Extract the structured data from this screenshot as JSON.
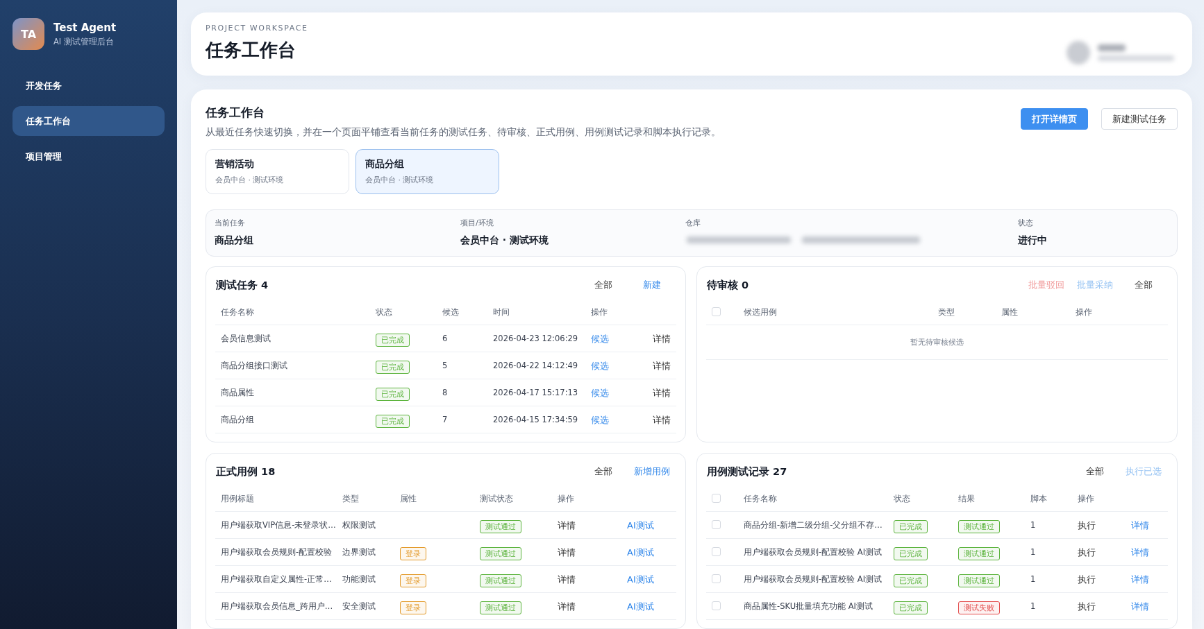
{
  "sidebar": {
    "logo": "TA",
    "app_name": "Test Agent",
    "app_subtitle": "AI 测试管理后台",
    "items": [
      {
        "label": "开发任务",
        "selected": false
      },
      {
        "label": "任务工作台",
        "selected": true
      },
      {
        "label": "项目管理",
        "selected": false
      }
    ]
  },
  "header": {
    "eyebrow": "PROJECT WORKSPACE",
    "title": "任务工作台",
    "profile": {
      "kind": "redacted"
    }
  },
  "workspace": {
    "title": "任务工作台",
    "description": "从最近任务快速切换，并在一个页面平铺查看当前任务的测试任务、待审核、正式用例、用例测试记录和脚本执行记录。",
    "buttons": [
      {
        "label": "打开详情页",
        "kind": "primary"
      },
      {
        "label": "新建测试任务",
        "kind": "default"
      }
    ],
    "recent_tasks": [
      {
        "name": "营销活动",
        "meta": "会员中台 · 测试环境",
        "selected": false
      },
      {
        "name": "商品分组",
        "meta": "会员中台 · 测试环境",
        "selected": true
      }
    ],
    "info": [
      {
        "label": "当前任务",
        "kind": "text",
        "value": "商品分组"
      },
      {
        "label": "项目/环境",
        "kind": "text",
        "value": "会员中台 · 测试环境"
      },
      {
        "label": "仓库",
        "kind": "redacted"
      },
      {
        "label": "状态",
        "kind": "text",
        "value": "进行中"
      }
    ],
    "panels": [
      {
        "kind": "tasks",
        "title": "测试任务",
        "count": "4",
        "actions": [
          {
            "label": "全部",
            "kind": "plain",
            "disabled": false
          },
          {
            "label": "新建",
            "kind": "link",
            "disabled": false
          }
        ],
        "columns": [
          "任务名称",
          "状态",
          "候选",
          "时间",
          "操作"
        ],
        "rows": [
          {
            "cells": [
              {
                "kind": "text",
                "text": "会员信息测试"
              },
              {
                "kind": "tag",
                "color": "#5bb33c",
                "text": "已完成"
              },
              {
                "kind": "text",
                "text": "6"
              },
              {
                "kind": "text",
                "text": "2026-04-23 12:06:29"
              },
              {
                "kind": "link",
                "text": "候选"
              },
              {
                "kind": "action",
                "text": "详情"
              }
            ]
          },
          {
            "cells": [
              {
                "kind": "text",
                "text": "商品分组接口测试"
              },
              {
                "kind": "tag",
                "color": "#5bb33c",
                "text": "已完成"
              },
              {
                "kind": "text",
                "text": "5"
              },
              {
                "kind": "text",
                "text": "2026-04-22 14:12:49"
              },
              {
                "kind": "link",
                "text": "候选"
              },
              {
                "kind": "action",
                "text": "详情"
              }
            ]
          },
          {
            "cells": [
              {
                "kind": "text",
                "text": "商品属性"
              },
              {
                "kind": "tag",
                "color": "#5bb33c",
                "text": "已完成"
              },
              {
                "kind": "text",
                "text": "8"
              },
              {
                "kind": "text",
                "text": "2026-04-17 15:17:13"
              },
              {
                "kind": "link",
                "text": "候选"
              },
              {
                "kind": "action",
                "text": "详情"
              }
            ]
          },
          {
            "cells": [
              {
                "kind": "text",
                "text": "商品分组"
              },
              {
                "kind": "tag",
                "color": "#5bb33c",
                "text": "已完成"
              },
              {
                "kind": "text",
                "text": "7"
              },
              {
                "kind": "text",
                "text": "2026-04-15 17:34:59"
              },
              {
                "kind": "link",
                "text": "候选"
              },
              {
                "kind": "action",
                "text": "详情"
              }
            ]
          }
        ]
      },
      {
        "kind": "review",
        "title": "待审核",
        "count": "0",
        "actions": [
          {
            "label": "批量驳回",
            "kind": "danger",
            "disabled": true
          },
          {
            "label": "批量采纳",
            "kind": "link",
            "disabled": true
          },
          {
            "label": "全部",
            "kind": "plain",
            "disabled": false
          }
        ],
        "header_checked": false,
        "columns": [
          "候选用例",
          "类型",
          "属性",
          "操作"
        ],
        "empty_text": "暂无待审核候选"
      },
      {
        "kind": "cases",
        "title": "正式用例",
        "count": "18",
        "actions": [
          {
            "label": "全部",
            "kind": "plain",
            "disabled": false
          },
          {
            "label": "新增用例",
            "kind": "link",
            "disabled": false
          }
        ],
        "columns": [
          "用例标题",
          "类型",
          "属性",
          "测试状态",
          "操作"
        ],
        "rows": [
          {
            "cells": [
              {
                "kind": "text",
                "text": "用户端获取VIP信息-未登录状…"
              },
              {
                "kind": "text",
                "text": "权限测试"
              },
              {
                "kind": "blank"
              },
              {
                "kind": "tag",
                "color": "#5bb33c",
                "text": "测试通过"
              },
              {
                "kind": "action",
                "text": "详情"
              },
              {
                "kind": "link",
                "text": "AI测试"
              }
            ]
          },
          {
            "cells": [
              {
                "kind": "text",
                "text": "用户端获取会员规则-配置校验"
              },
              {
                "kind": "text",
                "text": "边界测试"
              },
              {
                "kind": "tag",
                "color": "#e39a2a",
                "text": "登录"
              },
              {
                "kind": "tag",
                "color": "#5bb33c",
                "text": "测试通过"
              },
              {
                "kind": "action",
                "text": "详情"
              },
              {
                "kind": "link",
                "text": "AI测试"
              }
            ]
          },
          {
            "cells": [
              {
                "kind": "text",
                "text": "用户端获取自定义属性-正常…"
              },
              {
                "kind": "text",
                "text": "功能测试"
              },
              {
                "kind": "tag",
                "color": "#e39a2a",
                "text": "登录"
              },
              {
                "kind": "tag",
                "color": "#5bb33c",
                "text": "测试通过"
              },
              {
                "kind": "action",
                "text": "详情"
              },
              {
                "kind": "link",
                "text": "AI测试"
              }
            ]
          },
          {
            "cells": [
              {
                "kind": "text",
                "text": "用户端获取会员信息_跨用户…"
              },
              {
                "kind": "text",
                "text": "安全测试"
              },
              {
                "kind": "tag",
                "color": "#e39a2a",
                "text": "登录"
              },
              {
                "kind": "tag",
                "color": "#5bb33c",
                "text": "测试通过"
              },
              {
                "kind": "action",
                "text": "详情"
              },
              {
                "kind": "link",
                "text": "AI测试"
              }
            ]
          }
        ]
      },
      {
        "kind": "records",
        "title": "用例测试记录",
        "count": "27",
        "actions": [
          {
            "label": "全部",
            "kind": "plain",
            "disabled": false
          },
          {
            "label": "执行已选",
            "kind": "link",
            "disabled": true
          }
        ],
        "header_checked": false,
        "columns": [
          "任务名称",
          "状态",
          "结果",
          "脚本",
          "操作"
        ],
        "rows": [
          {
            "checked": false,
            "cells": [
              {
                "kind": "text",
                "text": "商品分组-新增二级分组-父分组不存…"
              },
              {
                "kind": "tag",
                "color": "#5bb33c",
                "text": "已完成"
              },
              {
                "kind": "tag",
                "color": "#5bb33c",
                "text": "测试通过"
              },
              {
                "kind": "text",
                "text": "1"
              },
              {
                "kind": "action",
                "text": "执行"
              },
              {
                "kind": "link",
                "text": "详情"
              }
            ]
          },
          {
            "checked": false,
            "cells": [
              {
                "kind": "text",
                "text": "用户端获取会员规则-配置校验 AI测试"
              },
              {
                "kind": "tag",
                "color": "#5bb33c",
                "text": "已完成"
              },
              {
                "kind": "tag",
                "color": "#5bb33c",
                "text": "测试通过"
              },
              {
                "kind": "text",
                "text": "1"
              },
              {
                "kind": "action",
                "text": "执行"
              },
              {
                "kind": "link",
                "text": "详情"
              }
            ]
          },
          {
            "checked": false,
            "cells": [
              {
                "kind": "text",
                "text": "用户端获取会员规则-配置校验 AI测试"
              },
              {
                "kind": "tag",
                "color": "#5bb33c",
                "text": "已完成"
              },
              {
                "kind": "tag",
                "color": "#5bb33c",
                "text": "测试通过"
              },
              {
                "kind": "text",
                "text": "1"
              },
              {
                "kind": "action",
                "text": "执行"
              },
              {
                "kind": "link",
                "text": "详情"
              }
            ]
          },
          {
            "checked": false,
            "cells": [
              {
                "kind": "text",
                "text": "商品属性-SKU批量填充功能 AI测试"
              },
              {
                "kind": "tag",
                "color": "#5bb33c",
                "text": "已完成"
              },
              {
                "kind": "tag",
                "color": "#e34d4d",
                "text": "测试失败"
              },
              {
                "kind": "text",
                "text": "1"
              },
              {
                "kind": "action",
                "text": "执行"
              },
              {
                "kind": "link",
                "text": "详情"
              }
            ]
          }
        ]
      }
    ]
  }
}
